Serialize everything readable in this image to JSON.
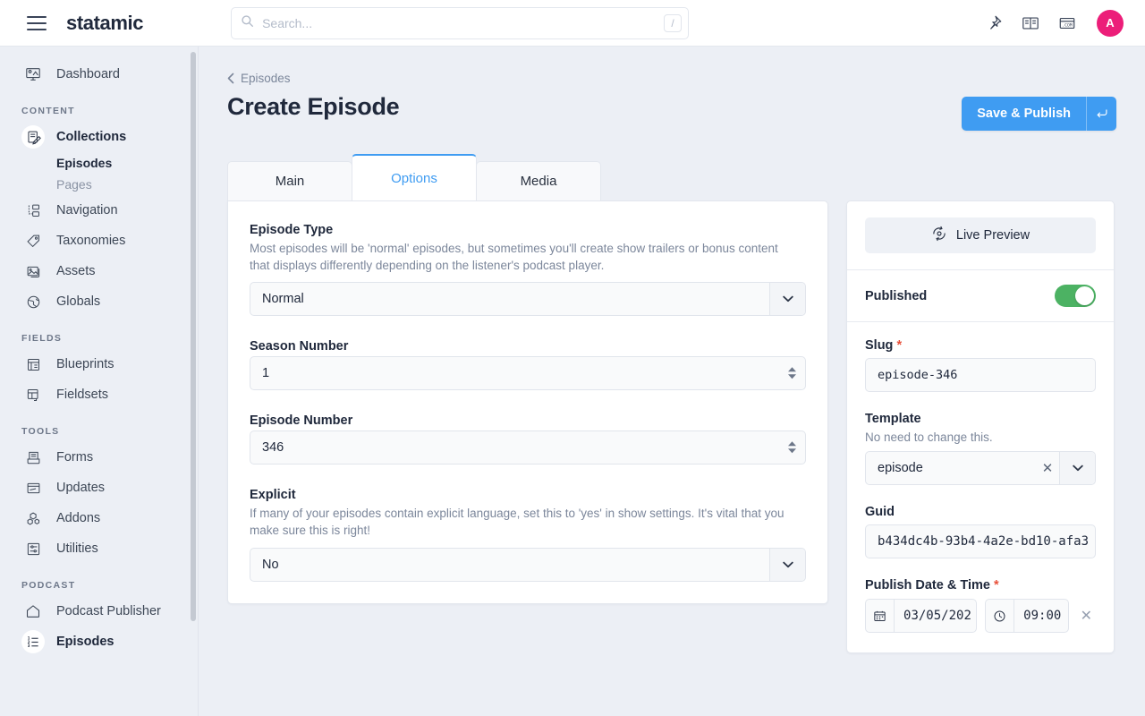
{
  "topbar": {
    "brand": "statamic",
    "menu_icon": "hamburger-icon",
    "search": {
      "placeholder": "Search...",
      "shortcut": "/",
      "icon": "search-icon"
    },
    "icons": [
      "pin-icon",
      "book-icon",
      "domain-card-icon"
    ],
    "avatar_initial": "A",
    "avatar_color": "#ec1e79"
  },
  "sidebar": {
    "top_items": [
      {
        "label": "Dashboard",
        "icon": "dashboard-icon"
      }
    ],
    "sections": [
      {
        "heading": "CONTENT",
        "items": [
          {
            "label": "Collections",
            "icon": "collections-icon",
            "active": true,
            "bold": true,
            "children": [
              {
                "label": "Episodes",
                "current": true
              },
              {
                "label": "Pages",
                "current": false
              }
            ]
          },
          {
            "label": "Navigation",
            "icon": "navigation-icon"
          },
          {
            "label": "Taxonomies",
            "icon": "taxonomies-icon"
          },
          {
            "label": "Assets",
            "icon": "assets-icon"
          },
          {
            "label": "Globals",
            "icon": "globals-icon"
          }
        ]
      },
      {
        "heading": "FIELDS",
        "items": [
          {
            "label": "Blueprints",
            "icon": "blueprints-icon"
          },
          {
            "label": "Fieldsets",
            "icon": "fieldsets-icon"
          }
        ]
      },
      {
        "heading": "TOOLS",
        "items": [
          {
            "label": "Forms",
            "icon": "forms-icon"
          },
          {
            "label": "Updates",
            "icon": "updates-icon"
          },
          {
            "label": "Addons",
            "icon": "addons-icon"
          },
          {
            "label": "Utilities",
            "icon": "utilities-icon"
          }
        ]
      },
      {
        "heading": "PODCAST",
        "items": [
          {
            "label": "Podcast Publisher",
            "icon": "home-icon"
          },
          {
            "label": "Episodes",
            "icon": "ordered-list-icon",
            "active": true,
            "bold": true
          }
        ]
      }
    ]
  },
  "header": {
    "breadcrumb": "Episodes",
    "title": "Create Episode",
    "save_label": "Save & Publish",
    "save_shortcut_icon": "enter-key-icon",
    "save_color": "#3f9cf2"
  },
  "tabs": [
    {
      "label": "Main",
      "active": false
    },
    {
      "label": "Options",
      "active": true
    },
    {
      "label": "Media",
      "active": false
    }
  ],
  "form": {
    "episode_type": {
      "label": "Episode Type",
      "help": "Most episodes will be 'normal' episodes, but sometimes you'll create show trailers or bonus content that displays differently depending on the listener's podcast player.",
      "value": "Normal"
    },
    "season_number": {
      "label": "Season Number",
      "value": "1"
    },
    "episode_number": {
      "label": "Episode Number",
      "value": "346"
    },
    "explicit": {
      "label": "Explicit",
      "help": "If many of your episodes contain explicit language, set this to 'yes' in show settings. It's vital that you make sure this is right!",
      "value": "No"
    }
  },
  "sidepanel": {
    "live_preview": {
      "label": "Live Preview",
      "icon": "live-preview-icon"
    },
    "published": {
      "label": "Published",
      "on": true,
      "color": "#4cb263"
    },
    "slug": {
      "label": "Slug",
      "required": true,
      "value": "episode-346"
    },
    "template": {
      "label": "Template",
      "help": "No need to change this.",
      "value": "episode",
      "clear_icon": "close-icon"
    },
    "guid": {
      "label": "Guid",
      "value": "b434dc4b-93b4-4a2e-bd10-afa3"
    },
    "publish_datetime": {
      "label": "Publish Date & Time",
      "required": true,
      "date": "03/05/202",
      "time": "09:00",
      "date_icon": "calendar-icon",
      "time_icon": "clock-icon",
      "clear_icon": "close-icon"
    }
  }
}
